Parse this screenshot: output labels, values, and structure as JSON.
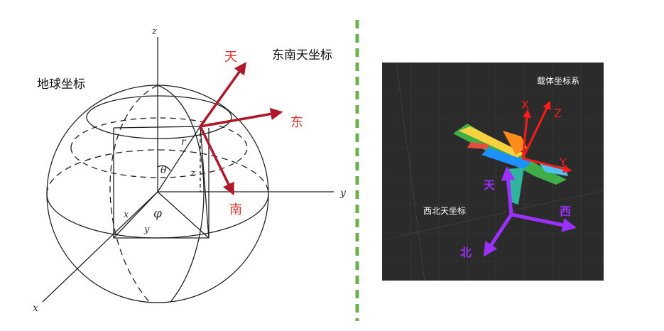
{
  "left": {
    "earth_label": "地球坐标",
    "enu_label": "东南天坐标",
    "axis_z": "z",
    "axis_y": "y",
    "axis_x": "x",
    "sym_r": "r",
    "sym_theta": "θ",
    "sym_phi": "φ",
    "sym_z_small": "z",
    "sym_x_small": "x",
    "sym_y_small": "y",
    "arrow_up": "天",
    "arrow_east": "东",
    "arrow_south": "南",
    "arrow_color": "#b0172a",
    "label_color": "#e03030"
  },
  "right": {
    "body_label": "载体坐标系",
    "world_label": "西北天坐标",
    "axis_X": "X",
    "axis_Y": "Y",
    "axis_Z": "Z",
    "arrow_tian": "天",
    "arrow_xi": "西",
    "arrow_bei": "北",
    "purple": "#9b30ff",
    "red": "#ff1a1a",
    "background": "#2b2b2b"
  },
  "divider": {
    "color": "#6ab04c"
  }
}
